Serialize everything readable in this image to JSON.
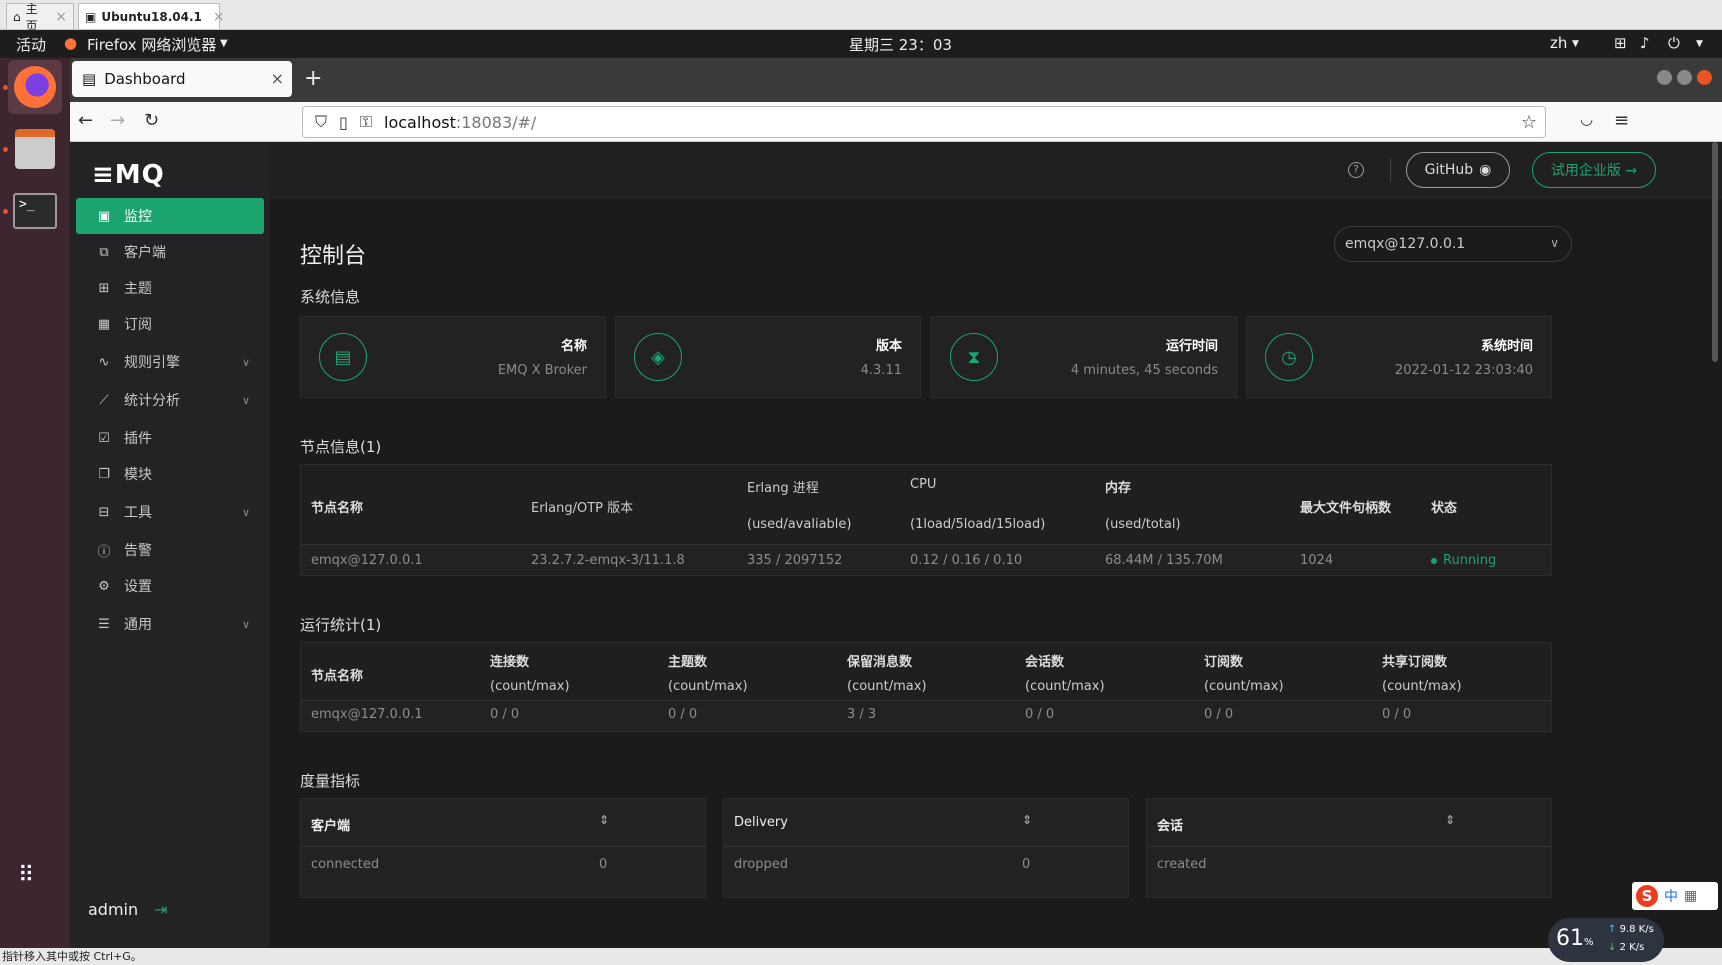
{
  "host_tabs": [
    {
      "label": "主页",
      "active": false
    },
    {
      "label": "Ubuntu18.04.1",
      "active": true
    }
  ],
  "gnome": {
    "activities": "活动",
    "app": "Firefox 网络浏览器",
    "clock": "星期三 23：03",
    "lang": "zh"
  },
  "browser": {
    "tab_title": "Dashboard",
    "url_host": "localhost",
    "url_path": ":18083/#/"
  },
  "sidebar": {
    "logo": "≡MQ",
    "items": [
      {
        "label": "监控",
        "icon": "monitor-icon",
        "active": true,
        "expandable": false
      },
      {
        "label": "客户端",
        "icon": "clients-icon",
        "active": false,
        "expandable": false
      },
      {
        "label": "主题",
        "icon": "topics-icon",
        "active": false,
        "expandable": false
      },
      {
        "label": "订阅",
        "icon": "subscriptions-icon",
        "active": false,
        "expandable": false
      },
      {
        "label": "规则引擎",
        "icon": "rules-icon",
        "active": false,
        "expandable": true
      },
      {
        "label": "统计分析",
        "icon": "analysis-icon",
        "active": false,
        "expandable": true
      },
      {
        "label": "插件",
        "icon": "plugins-icon",
        "active": false,
        "expandable": false
      },
      {
        "label": "模块",
        "icon": "modules-icon",
        "active": false,
        "expandable": false
      },
      {
        "label": "工具",
        "icon": "tools-icon",
        "active": false,
        "expandable": true
      },
      {
        "label": "告警",
        "icon": "alarm-icon",
        "active": false,
        "expandable": false
      },
      {
        "label": "设置",
        "icon": "settings-icon",
        "active": false,
        "expandable": false
      },
      {
        "label": "通用",
        "icon": "general-icon",
        "active": false,
        "expandable": true
      }
    ],
    "user": "admin"
  },
  "topbar": {
    "github": "GitHub",
    "enterprise": "试用企业版 →"
  },
  "main": {
    "title": "控制台",
    "node_select": "emqx@127.0.0.1",
    "sys_info_title": "系统信息",
    "sys_info": [
      {
        "label": "名称",
        "value": "EMQ X Broker",
        "icon": "document-icon"
      },
      {
        "label": "版本",
        "value": "4.3.11",
        "icon": "layers-icon"
      },
      {
        "label": "运行时间",
        "value": "4 minutes, 45 seconds",
        "icon": "hourglass-icon"
      },
      {
        "label": "系统时间",
        "value": "2022-01-12 23:03:40",
        "icon": "clock-icon"
      }
    ],
    "nodes_title": "节点信息(1)",
    "nodes_headers": {
      "name": "节点名称",
      "otp": "Erlang/OTP 版本",
      "proc": "Erlang 进程",
      "proc_sub": "(used/avaliable)",
      "cpu": "CPU",
      "cpu_sub": "(1load/5load/15load)",
      "mem": "内存",
      "mem_sub": "(used/total)",
      "fds": "最大文件句柄数",
      "status": "状态"
    },
    "nodes_row": {
      "name": "emqx@127.0.0.1",
      "otp": "23.2.7.2-emqx-3/11.1.8",
      "proc": "335 / 2097152",
      "cpu": "0.12 / 0.16 / 0.10",
      "mem": "68.44M / 135.70M",
      "fds": "1024",
      "status": "Running"
    },
    "stats_title": "运行统计(1)",
    "stats_headers": {
      "name": "节点名称",
      "cols": [
        "连接数",
        "主题数",
        "保留消息数",
        "会话数",
        "订阅数",
        "共享订阅数"
      ],
      "sub": "(count/max)"
    },
    "stats_row": {
      "name": "emqx@127.0.0.1",
      "vals": [
        "0 / 0",
        "0 / 0",
        "3 / 3",
        "0 / 0",
        "0 / 0",
        "0 / 0"
      ]
    },
    "metrics_title": "度量指标",
    "metrics": [
      {
        "title": "客户端",
        "key": "connected",
        "value": "0"
      },
      {
        "title": "Delivery",
        "key": "dropped",
        "value": "0"
      },
      {
        "title": "会话",
        "key": "created",
        "value": ""
      }
    ]
  },
  "overlays": {
    "statusline": "指针移入其中或按 Ctrl+G。",
    "ime": "中",
    "net_pct": "61",
    "net_pct_unit": "%",
    "net_up": "9.8",
    "net_down": "2",
    "net_unit": "K/s"
  }
}
